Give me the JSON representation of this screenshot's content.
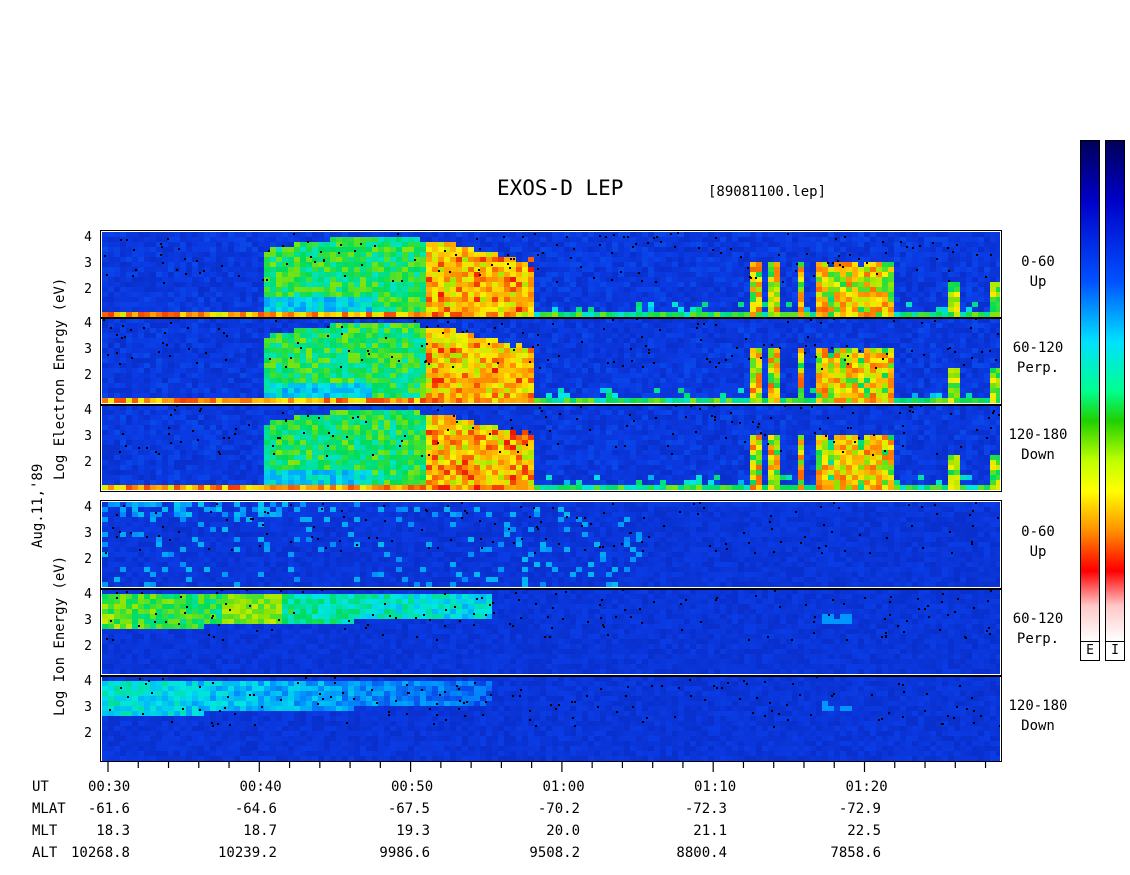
{
  "chart_data": {
    "type": "heatmap",
    "title": "EXOS-D LEP",
    "file_label": "[89081100.lep]",
    "date_label": "Aug.11,'89",
    "y_ticks": [
      "4",
      "3",
      "2"
    ],
    "groups": [
      {
        "name": "Electron",
        "ylabel": "Log Electron Energy (eV)",
        "ylabel_words": [
          "Log",
          "Electron",
          "Energy",
          "(eV)"
        ],
        "panels": [
          {
            "pitch": "0-60",
            "direction": "Up"
          },
          {
            "pitch": "60-120",
            "direction": "Perp."
          },
          {
            "pitch": "120-180",
            "direction": "Down"
          }
        ]
      },
      {
        "name": "Ion",
        "ylabel": "Log Ion Energy (eV)",
        "ylabel_words": [
          "Log",
          "Ion",
          "Energy",
          "(eV)"
        ],
        "panels": [
          {
            "pitch": "0-60",
            "direction": "Up"
          },
          {
            "pitch": "60-120",
            "direction": "Perp."
          },
          {
            "pitch": "120-180",
            "direction": "Down"
          }
        ]
      }
    ],
    "x_ticks": [
      "00:30",
      "00:40",
      "00:50",
      "01:00",
      "01:10",
      "01:20"
    ],
    "ephemeris": [
      {
        "label": "UT",
        "values": [
          "00:30",
          "00:40",
          "00:50",
          "01:00",
          "01:10",
          "01:20"
        ]
      },
      {
        "label": "MLAT",
        "values": [
          "-61.6",
          "-64.6",
          "-67.5",
          "-70.2",
          "-72.3",
          "-72.9"
        ]
      },
      {
        "label": "MLT",
        "values": [
          "18.3",
          "18.7",
          "19.3",
          "20.0",
          "21.1",
          "22.5"
        ]
      },
      {
        "label": "ALT",
        "values": [
          "10268.8",
          "10239.2",
          "9986.6",
          "9508.2",
          "8800.4",
          "7858.6"
        ]
      }
    ],
    "colorbar_labels": [
      "E",
      "I"
    ],
    "colorscale": [
      "#ffffff",
      "#ff0000",
      "#ff8000",
      "#ffff00",
      "#00d000",
      "#00ffff",
      "#0060ff",
      "#0000a0",
      "#000050"
    ]
  }
}
